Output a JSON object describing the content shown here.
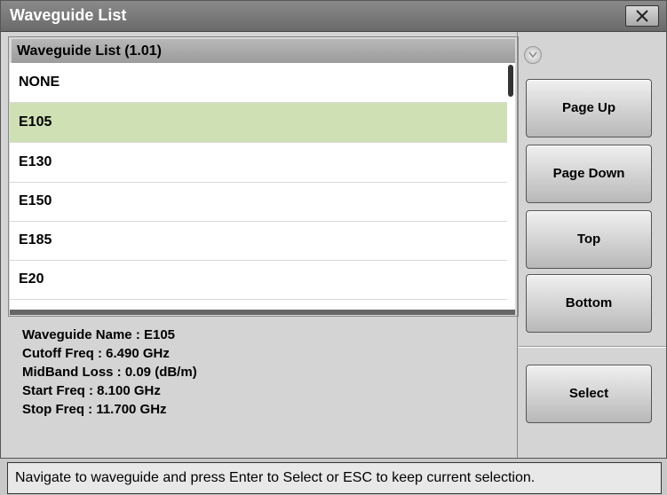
{
  "window": {
    "title": "Waveguide List"
  },
  "list": {
    "header": "Waveguide List (1.01)",
    "items": [
      "NONE",
      "E105",
      "E130",
      "E150",
      "E185",
      "E20"
    ],
    "selected": "E105"
  },
  "info": {
    "name": "Waveguide Name : E105",
    "cutoff": "Cutoff Freq : 6.490 GHz",
    "midband": "MidBand Loss : 0.09 (dB/m)",
    "start": "Start Freq : 8.100 GHz",
    "stop": "Stop Freq : 11.700 GHz"
  },
  "buttons": {
    "page_up": "Page Up",
    "page_down": "Page Down",
    "top": "Top",
    "bottom": "Bottom",
    "select": "Select"
  },
  "status": "Navigate to waveguide and press Enter to Select or ESC to keep current selection.",
  "colors": {
    "selected_row": "#cfe0b4",
    "titlebar": "#7a7a7a"
  },
  "icons": {
    "close": "close-icon",
    "scroll": "chevron-down-icon"
  }
}
